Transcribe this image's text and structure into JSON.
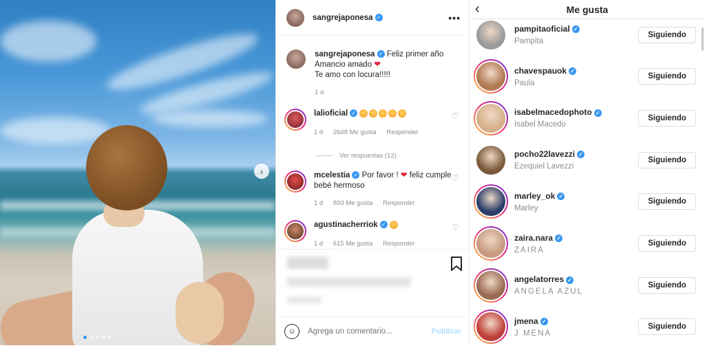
{
  "post": {
    "username": "sangrejaponesa",
    "more_icon": "more-horizontal-icon",
    "caption": {
      "username": "sangrejaponesa",
      "line1": "Feliz primer año",
      "line2": "Amancio amado",
      "line3": "Te amo con locura!!!!!",
      "time": "1 d"
    },
    "comments": [
      {
        "username": "lalioficial",
        "text": "",
        "emoji_count": 5,
        "time": "1 d",
        "likes": "2648 Me gusta",
        "reply": "Responder"
      },
      {
        "username": "mcelestia",
        "text_a": "Por favor !",
        "text_b": "feliz cumple bebé hermoso",
        "time": "1 d",
        "likes": "893 Me gusta",
        "reply": "Responder"
      },
      {
        "username": "agustinacherriok",
        "text": "",
        "emoji_count": 1,
        "time": "1 d",
        "likes": "615 Me gusta",
        "reply": "Responder"
      }
    ],
    "view_replies": "Ver respuestas (12)",
    "comment_placeholder": "Agrega un comentario...",
    "publish_label": "Publicar"
  },
  "likes_panel": {
    "title": "Me gusta",
    "button_label": "Siguiendo",
    "users": [
      {
        "handle": "pampitaoficial",
        "name": "Pampita",
        "story": false,
        "color": "#9a9a9a"
      },
      {
        "handle": "chavespauok",
        "name": "Paula",
        "story": true,
        "color": "#b07a52"
      },
      {
        "handle": "isabelmacedophoto",
        "name": "Isabel Macedo",
        "story": true,
        "color": "#d6b08a"
      },
      {
        "handle": "pocho22lavezzi",
        "name": "Ezequiel Lavezzi",
        "story": false,
        "color": "#7a5a3a"
      },
      {
        "handle": "marley_ok",
        "name": "Marley",
        "story": true,
        "color": "#2a3e6a"
      },
      {
        "handle": "zaira.nara",
        "name": "ZAIRA",
        "story": true,
        "color": "#c79a80"
      },
      {
        "handle": "angelatorres",
        "name": "ANGELA AZUL",
        "story": true,
        "color": "#9a6a52"
      },
      {
        "handle": "jmena",
        "name": "J MENA",
        "story": true,
        "color": "#c0403a"
      }
    ]
  }
}
